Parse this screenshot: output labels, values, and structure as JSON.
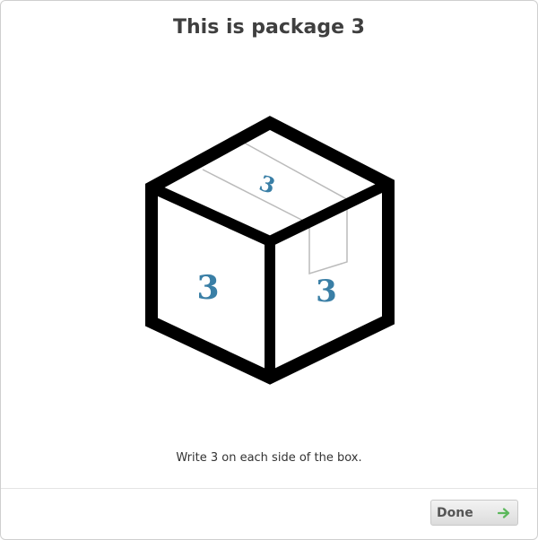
{
  "dialog": {
    "title": "This is package 3",
    "instruction": "Write 3 on each side of the box.",
    "done_label": "Done",
    "done_icon": "arrow-right-icon",
    "accent_color": "#5cb85c"
  },
  "package": {
    "number": "3",
    "label_color": "#3a7fa6",
    "outline_color": "#000000",
    "tape_color": "#bbbbbb"
  }
}
